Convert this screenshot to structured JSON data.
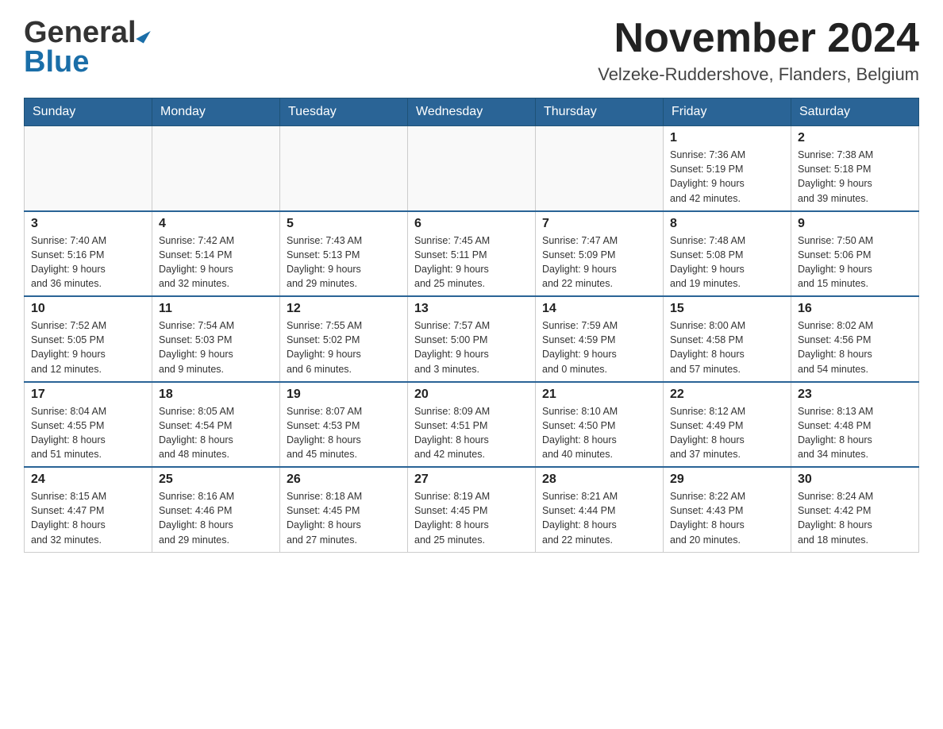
{
  "header": {
    "logo_general": "General",
    "logo_blue": "Blue",
    "month_title": "November 2024",
    "location": "Velzeke-Ruddershove, Flanders, Belgium"
  },
  "calendar": {
    "days_of_week": [
      "Sunday",
      "Monday",
      "Tuesday",
      "Wednesday",
      "Thursday",
      "Friday",
      "Saturday"
    ],
    "weeks": [
      {
        "days": [
          {
            "number": "",
            "info": ""
          },
          {
            "number": "",
            "info": ""
          },
          {
            "number": "",
            "info": ""
          },
          {
            "number": "",
            "info": ""
          },
          {
            "number": "",
            "info": ""
          },
          {
            "number": "1",
            "info": "Sunrise: 7:36 AM\nSunset: 5:19 PM\nDaylight: 9 hours\nand 42 minutes."
          },
          {
            "number": "2",
            "info": "Sunrise: 7:38 AM\nSunset: 5:18 PM\nDaylight: 9 hours\nand 39 minutes."
          }
        ]
      },
      {
        "days": [
          {
            "number": "3",
            "info": "Sunrise: 7:40 AM\nSunset: 5:16 PM\nDaylight: 9 hours\nand 36 minutes."
          },
          {
            "number": "4",
            "info": "Sunrise: 7:42 AM\nSunset: 5:14 PM\nDaylight: 9 hours\nand 32 minutes."
          },
          {
            "number": "5",
            "info": "Sunrise: 7:43 AM\nSunset: 5:13 PM\nDaylight: 9 hours\nand 29 minutes."
          },
          {
            "number": "6",
            "info": "Sunrise: 7:45 AM\nSunset: 5:11 PM\nDaylight: 9 hours\nand 25 minutes."
          },
          {
            "number": "7",
            "info": "Sunrise: 7:47 AM\nSunset: 5:09 PM\nDaylight: 9 hours\nand 22 minutes."
          },
          {
            "number": "8",
            "info": "Sunrise: 7:48 AM\nSunset: 5:08 PM\nDaylight: 9 hours\nand 19 minutes."
          },
          {
            "number": "9",
            "info": "Sunrise: 7:50 AM\nSunset: 5:06 PM\nDaylight: 9 hours\nand 15 minutes."
          }
        ]
      },
      {
        "days": [
          {
            "number": "10",
            "info": "Sunrise: 7:52 AM\nSunset: 5:05 PM\nDaylight: 9 hours\nand 12 minutes."
          },
          {
            "number": "11",
            "info": "Sunrise: 7:54 AM\nSunset: 5:03 PM\nDaylight: 9 hours\nand 9 minutes."
          },
          {
            "number": "12",
            "info": "Sunrise: 7:55 AM\nSunset: 5:02 PM\nDaylight: 9 hours\nand 6 minutes."
          },
          {
            "number": "13",
            "info": "Sunrise: 7:57 AM\nSunset: 5:00 PM\nDaylight: 9 hours\nand 3 minutes."
          },
          {
            "number": "14",
            "info": "Sunrise: 7:59 AM\nSunset: 4:59 PM\nDaylight: 9 hours\nand 0 minutes."
          },
          {
            "number": "15",
            "info": "Sunrise: 8:00 AM\nSunset: 4:58 PM\nDaylight: 8 hours\nand 57 minutes."
          },
          {
            "number": "16",
            "info": "Sunrise: 8:02 AM\nSunset: 4:56 PM\nDaylight: 8 hours\nand 54 minutes."
          }
        ]
      },
      {
        "days": [
          {
            "number": "17",
            "info": "Sunrise: 8:04 AM\nSunset: 4:55 PM\nDaylight: 8 hours\nand 51 minutes."
          },
          {
            "number": "18",
            "info": "Sunrise: 8:05 AM\nSunset: 4:54 PM\nDaylight: 8 hours\nand 48 minutes."
          },
          {
            "number": "19",
            "info": "Sunrise: 8:07 AM\nSunset: 4:53 PM\nDaylight: 8 hours\nand 45 minutes."
          },
          {
            "number": "20",
            "info": "Sunrise: 8:09 AM\nSunset: 4:51 PM\nDaylight: 8 hours\nand 42 minutes."
          },
          {
            "number": "21",
            "info": "Sunrise: 8:10 AM\nSunset: 4:50 PM\nDaylight: 8 hours\nand 40 minutes."
          },
          {
            "number": "22",
            "info": "Sunrise: 8:12 AM\nSunset: 4:49 PM\nDaylight: 8 hours\nand 37 minutes."
          },
          {
            "number": "23",
            "info": "Sunrise: 8:13 AM\nSunset: 4:48 PM\nDaylight: 8 hours\nand 34 minutes."
          }
        ]
      },
      {
        "days": [
          {
            "number": "24",
            "info": "Sunrise: 8:15 AM\nSunset: 4:47 PM\nDaylight: 8 hours\nand 32 minutes."
          },
          {
            "number": "25",
            "info": "Sunrise: 8:16 AM\nSunset: 4:46 PM\nDaylight: 8 hours\nand 29 minutes."
          },
          {
            "number": "26",
            "info": "Sunrise: 8:18 AM\nSunset: 4:45 PM\nDaylight: 8 hours\nand 27 minutes."
          },
          {
            "number": "27",
            "info": "Sunrise: 8:19 AM\nSunset: 4:45 PM\nDaylight: 8 hours\nand 25 minutes."
          },
          {
            "number": "28",
            "info": "Sunrise: 8:21 AM\nSunset: 4:44 PM\nDaylight: 8 hours\nand 22 minutes."
          },
          {
            "number": "29",
            "info": "Sunrise: 8:22 AM\nSunset: 4:43 PM\nDaylight: 8 hours\nand 20 minutes."
          },
          {
            "number": "30",
            "info": "Sunrise: 8:24 AM\nSunset: 4:42 PM\nDaylight: 8 hours\nand 18 minutes."
          }
        ]
      }
    ]
  }
}
